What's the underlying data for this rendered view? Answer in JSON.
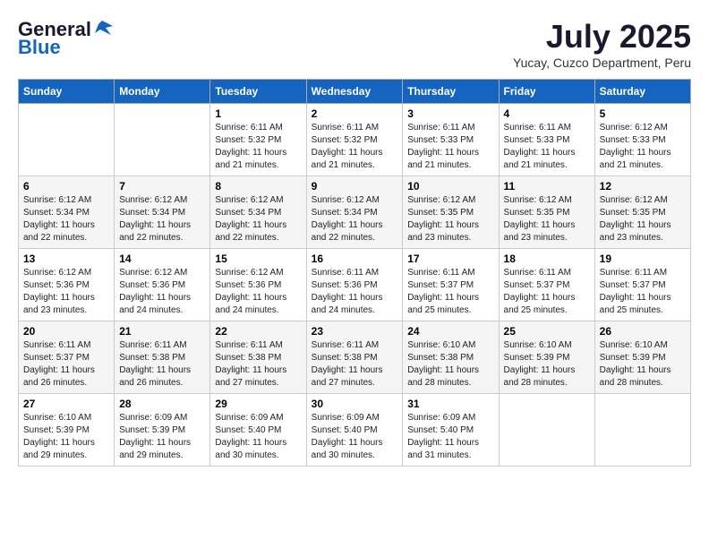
{
  "header": {
    "logo_general": "General",
    "logo_blue": "Blue",
    "month_year": "July 2025",
    "location": "Yucay, Cuzco Department, Peru"
  },
  "days_of_week": [
    "Sunday",
    "Monday",
    "Tuesday",
    "Wednesday",
    "Thursday",
    "Friday",
    "Saturday"
  ],
  "weeks": [
    [
      {
        "day": "",
        "info": ""
      },
      {
        "day": "",
        "info": ""
      },
      {
        "day": "1",
        "sunrise": "6:11 AM",
        "sunset": "5:32 PM",
        "daylight": "11 hours and 21 minutes."
      },
      {
        "day": "2",
        "sunrise": "6:11 AM",
        "sunset": "5:32 PM",
        "daylight": "11 hours and 21 minutes."
      },
      {
        "day": "3",
        "sunrise": "6:11 AM",
        "sunset": "5:33 PM",
        "daylight": "11 hours and 21 minutes."
      },
      {
        "day": "4",
        "sunrise": "6:11 AM",
        "sunset": "5:33 PM",
        "daylight": "11 hours and 21 minutes."
      },
      {
        "day": "5",
        "sunrise": "6:12 AM",
        "sunset": "5:33 PM",
        "daylight": "11 hours and 21 minutes."
      }
    ],
    [
      {
        "day": "6",
        "sunrise": "6:12 AM",
        "sunset": "5:34 PM",
        "daylight": "11 hours and 22 minutes."
      },
      {
        "day": "7",
        "sunrise": "6:12 AM",
        "sunset": "5:34 PM",
        "daylight": "11 hours and 22 minutes."
      },
      {
        "day": "8",
        "sunrise": "6:12 AM",
        "sunset": "5:34 PM",
        "daylight": "11 hours and 22 minutes."
      },
      {
        "day": "9",
        "sunrise": "6:12 AM",
        "sunset": "5:34 PM",
        "daylight": "11 hours and 22 minutes."
      },
      {
        "day": "10",
        "sunrise": "6:12 AM",
        "sunset": "5:35 PM",
        "daylight": "11 hours and 23 minutes."
      },
      {
        "day": "11",
        "sunrise": "6:12 AM",
        "sunset": "5:35 PM",
        "daylight": "11 hours and 23 minutes."
      },
      {
        "day": "12",
        "sunrise": "6:12 AM",
        "sunset": "5:35 PM",
        "daylight": "11 hours and 23 minutes."
      }
    ],
    [
      {
        "day": "13",
        "sunrise": "6:12 AM",
        "sunset": "5:36 PM",
        "daylight": "11 hours and 23 minutes."
      },
      {
        "day": "14",
        "sunrise": "6:12 AM",
        "sunset": "5:36 PM",
        "daylight": "11 hours and 24 minutes."
      },
      {
        "day": "15",
        "sunrise": "6:12 AM",
        "sunset": "5:36 PM",
        "daylight": "11 hours and 24 minutes."
      },
      {
        "day": "16",
        "sunrise": "6:11 AM",
        "sunset": "5:36 PM",
        "daylight": "11 hours and 24 minutes."
      },
      {
        "day": "17",
        "sunrise": "6:11 AM",
        "sunset": "5:37 PM",
        "daylight": "11 hours and 25 minutes."
      },
      {
        "day": "18",
        "sunrise": "6:11 AM",
        "sunset": "5:37 PM",
        "daylight": "11 hours and 25 minutes."
      },
      {
        "day": "19",
        "sunrise": "6:11 AM",
        "sunset": "5:37 PM",
        "daylight": "11 hours and 25 minutes."
      }
    ],
    [
      {
        "day": "20",
        "sunrise": "6:11 AM",
        "sunset": "5:37 PM",
        "daylight": "11 hours and 26 minutes."
      },
      {
        "day": "21",
        "sunrise": "6:11 AM",
        "sunset": "5:38 PM",
        "daylight": "11 hours and 26 minutes."
      },
      {
        "day": "22",
        "sunrise": "6:11 AM",
        "sunset": "5:38 PM",
        "daylight": "11 hours and 27 minutes."
      },
      {
        "day": "23",
        "sunrise": "6:11 AM",
        "sunset": "5:38 PM",
        "daylight": "11 hours and 27 minutes."
      },
      {
        "day": "24",
        "sunrise": "6:10 AM",
        "sunset": "5:38 PM",
        "daylight": "11 hours and 28 minutes."
      },
      {
        "day": "25",
        "sunrise": "6:10 AM",
        "sunset": "5:39 PM",
        "daylight": "11 hours and 28 minutes."
      },
      {
        "day": "26",
        "sunrise": "6:10 AM",
        "sunset": "5:39 PM",
        "daylight": "11 hours and 28 minutes."
      }
    ],
    [
      {
        "day": "27",
        "sunrise": "6:10 AM",
        "sunset": "5:39 PM",
        "daylight": "11 hours and 29 minutes."
      },
      {
        "day": "28",
        "sunrise": "6:09 AM",
        "sunset": "5:39 PM",
        "daylight": "11 hours and 29 minutes."
      },
      {
        "day": "29",
        "sunrise": "6:09 AM",
        "sunset": "5:40 PM",
        "daylight": "11 hours and 30 minutes."
      },
      {
        "day": "30",
        "sunrise": "6:09 AM",
        "sunset": "5:40 PM",
        "daylight": "11 hours and 30 minutes."
      },
      {
        "day": "31",
        "sunrise": "6:09 AM",
        "sunset": "5:40 PM",
        "daylight": "11 hours and 31 minutes."
      },
      {
        "day": "",
        "info": ""
      },
      {
        "day": "",
        "info": ""
      }
    ]
  ],
  "labels": {
    "sunrise": "Sunrise:",
    "sunset": "Sunset:",
    "daylight": "Daylight:"
  }
}
